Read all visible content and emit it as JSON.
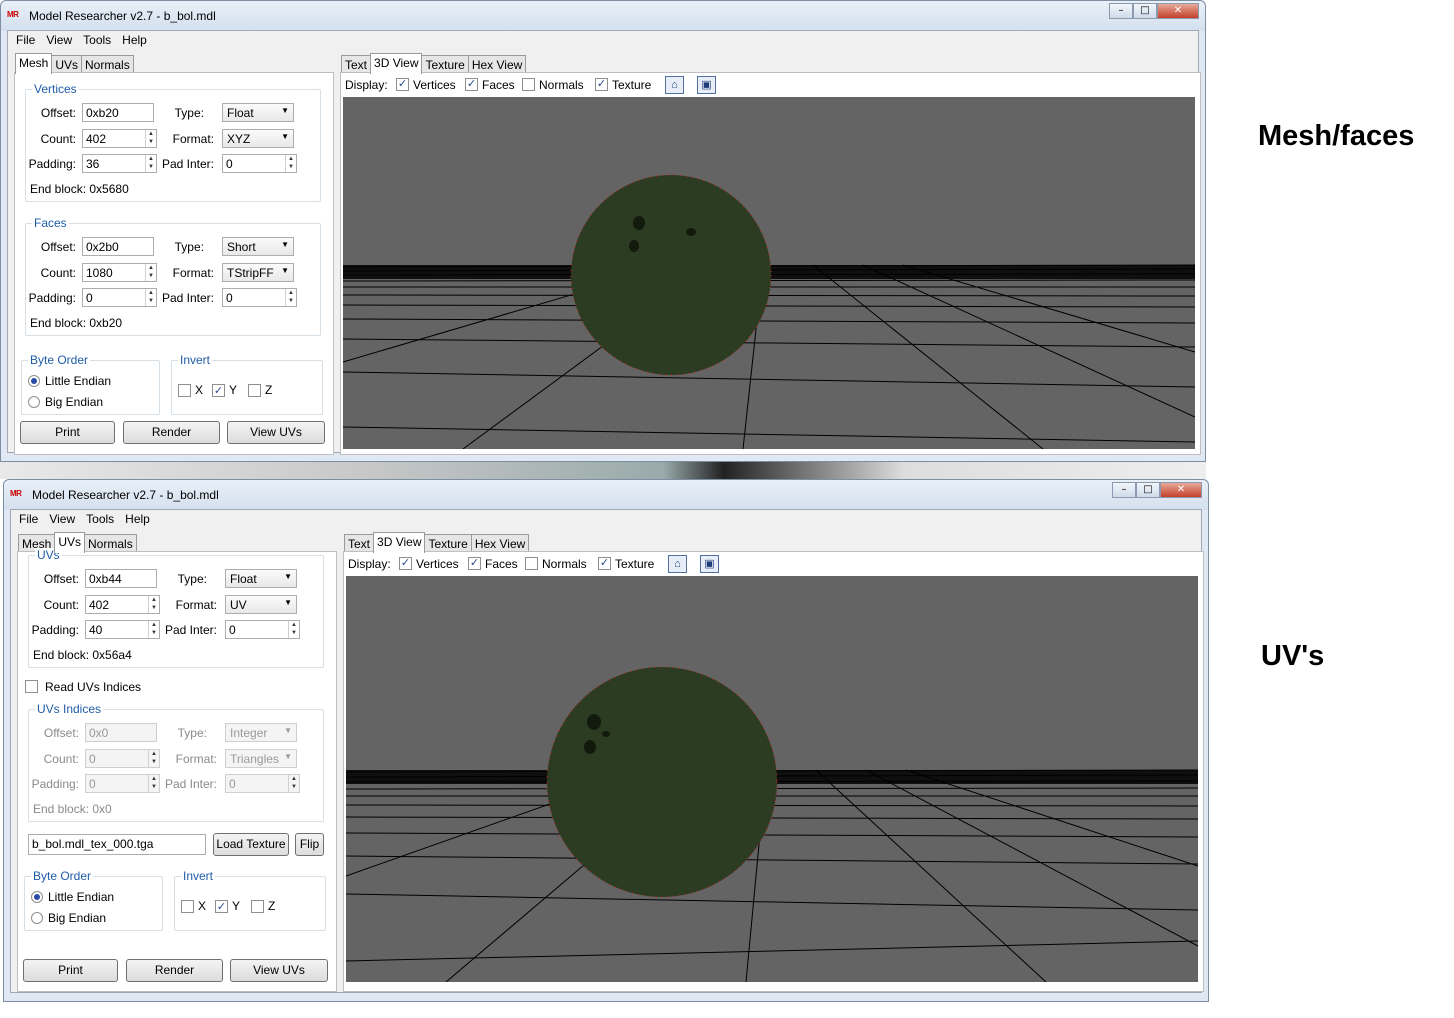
{
  "window1": {
    "title": "Model Researcher v2.7 - b_bol.mdl",
    "menu": [
      "File",
      "View",
      "Tools",
      "Help"
    ],
    "left_tabs": [
      "Mesh",
      "UVs",
      "Normals"
    ],
    "vertices": {
      "title": "Vertices",
      "offset_label": "Offset:",
      "offset": "0xb20",
      "type_label": "Type:",
      "type": "Float",
      "count_label": "Count:",
      "count": "402",
      "format_label": "Format:",
      "format": "XYZ",
      "padding_label": "Padding:",
      "padding": "36",
      "padinter_label": "Pad Inter:",
      "padinter": "0",
      "endblock": "End block: 0x5680"
    },
    "faces": {
      "title": "Faces",
      "offset_label": "Offset:",
      "offset": "0x2b0",
      "type_label": "Type:",
      "type": "Short",
      "count_label": "Count:",
      "count": "1080",
      "format_label": "Format:",
      "format": "TStripFF",
      "padding_label": "Padding:",
      "padding": "0",
      "padinter_label": "Pad Inter:",
      "padinter": "0",
      "endblock": "End block: 0xb20"
    },
    "byteorder": {
      "title": "Byte Order",
      "little": "Little Endian",
      "big": "Big Endian"
    },
    "invert": {
      "title": "Invert",
      "x": "X",
      "y": "Y",
      "z": "Z"
    },
    "buttons": {
      "print": "Print",
      "render": "Render",
      "viewuvs": "View UVs"
    },
    "right_tabs": [
      "Text",
      "3D View",
      "Texture",
      "Hex View"
    ],
    "display": {
      "label": "Display:",
      "vertices": "Vertices",
      "faces": "Faces",
      "normals": "Normals",
      "texture": "Texture"
    }
  },
  "window2": {
    "title": "Model Researcher v2.7 - b_bol.mdl",
    "menu": [
      "File",
      "View",
      "Tools",
      "Help"
    ],
    "left_tabs": [
      "Mesh",
      "UVs",
      "Normals"
    ],
    "uvs": {
      "title": "UVs",
      "offset_label": "Offset:",
      "offset": "0xb44",
      "type_label": "Type:",
      "type": "Float",
      "count_label": "Count:",
      "count": "402",
      "format_label": "Format:",
      "format": "UV",
      "padding_label": "Padding:",
      "padding": "40",
      "padinter_label": "Pad Inter:",
      "padinter": "0",
      "endblock": "End block: 0x56a4"
    },
    "read_indices": "Read UVs Indices",
    "uvs_indices": {
      "title": "UVs Indices",
      "offset_label": "Offset:",
      "offset": "0x0",
      "type_label": "Type:",
      "type": "Integer",
      "count_label": "Count:",
      "count": "0",
      "format_label": "Format:",
      "format": "Triangles",
      "padding_label": "Padding:",
      "padding": "0",
      "padinter_label": "Pad Inter:",
      "padinter": "0",
      "endblock": "End block: 0x0"
    },
    "texture_file": "b_bol.mdl_tex_000.tga",
    "load_texture": "Load Texture",
    "flip": "Flip",
    "byteorder": {
      "title": "Byte Order",
      "little": "Little Endian",
      "big": "Big Endian"
    },
    "invert": {
      "title": "Invert",
      "x": "X",
      "y": "Y",
      "z": "Z"
    },
    "buttons": {
      "print": "Print",
      "render": "Render",
      "viewuvs": "View UVs"
    },
    "right_tabs": [
      "Text",
      "3D View",
      "Texture",
      "Hex View"
    ],
    "display": {
      "label": "Display:",
      "vertices": "Vertices",
      "faces": "Faces",
      "normals": "Normals",
      "texture": "Texture"
    }
  },
  "captions": {
    "mesh": "Mesh/faces",
    "uv": "UV's"
  },
  "colors": {
    "viewport_bg": "#646464",
    "sphere": "#2c3c22",
    "vertex_dots": "#cc2222",
    "accent": "#1e5ca8"
  },
  "icons": [
    "home-icon",
    "fit-view-icon"
  ]
}
